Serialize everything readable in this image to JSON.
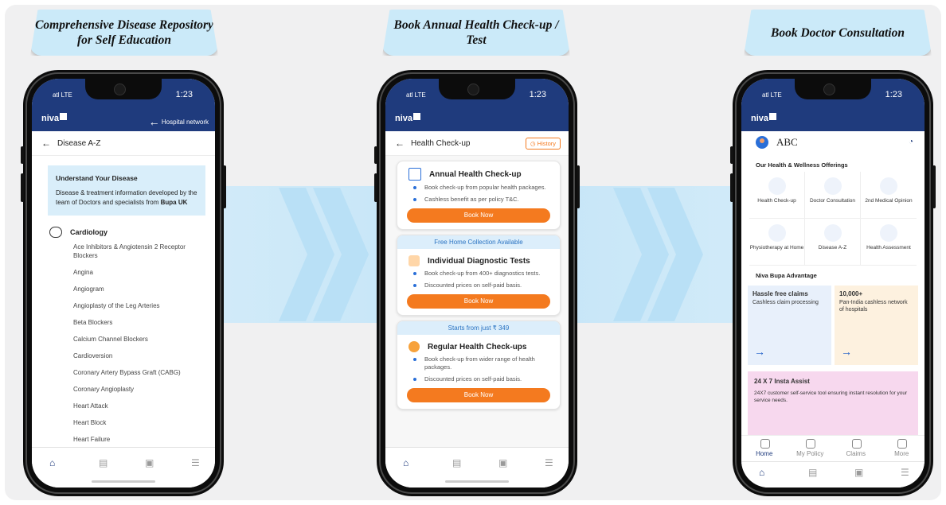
{
  "banners": [
    "Comprehensive Disease Repository for Self Education",
    "Book Annual Health Check-up / Test",
    "Book Doctor Consultation"
  ],
  "status": {
    "signal": "atl LTE",
    "time": "1:23"
  },
  "logo": "niva",
  "phone1": {
    "hospital_link": "Hospital network",
    "header": "Disease A-Z",
    "info_title": "Understand Your Disease",
    "info_text": "Disease & treatment information developed by the team of Doctors and specialists from",
    "info_brand": "Bupa UK",
    "section": "Cardiology",
    "diseases": [
      "Ace Inhibitors & Angiotensin 2 Receptor Blockers",
      "Angina",
      "Angiogram",
      "Angioplasty of the Leg Arteries",
      "Beta Blockers",
      "Calcium Channel Blockers",
      "Cardioversion",
      "Coronary Artery Bypass Graft (CABG)",
      "Coronary Angioplasty",
      "Heart Attack",
      "Heart Block",
      "Heart Failure"
    ]
  },
  "phone2": {
    "header": "Health Check-up",
    "history": "History",
    "cards": [
      {
        "strip": "",
        "title": "Annual Health Check-up",
        "points": [
          "Book check-up from popular health packages.",
          "Cashless benefit as per policy T&C."
        ],
        "button": "Book Now"
      },
      {
        "strip": "Free Home Collection Available",
        "title": "Individual Diagnostic Tests",
        "points": [
          "Book check-up from 400+ diagnostics tests.",
          "Discounted prices on self-paid basis."
        ],
        "button": "Book Now"
      },
      {
        "strip": "Starts from just ₹ 349",
        "title": "Regular Health Check-ups",
        "points": [
          "Book check-up from wider range of health packages.",
          "Discounted prices on self-paid basis."
        ],
        "button": "Book Now"
      }
    ]
  },
  "phone3": {
    "user": "ABC",
    "offerings_title": "Our Health & Wellness Offerings",
    "offerings": [
      "Health Check-up",
      "Doctor Consultation",
      "2nd Medical Opinion",
      "Physiotherapy at Home",
      "Disease A-Z",
      "Health Assessment"
    ],
    "advantage_title": "Niva Bupa Advantage",
    "advantages": [
      {
        "title": "Hassle free claims",
        "text": "Cashless claim processing"
      },
      {
        "title": "10,000+",
        "text": "Pan-India cashless network of hospitals"
      }
    ],
    "insta_title": "24 X 7 Insta Assist",
    "insta_text": "24X7 customer self-service tool ensuring instant resolution for your service needs.",
    "nav": [
      "Home",
      "My Policy",
      "Claims",
      "More"
    ]
  },
  "colors": {
    "brand": "#1f3b7d",
    "accent": "#f47a1f",
    "band": "#c6e6f8"
  }
}
